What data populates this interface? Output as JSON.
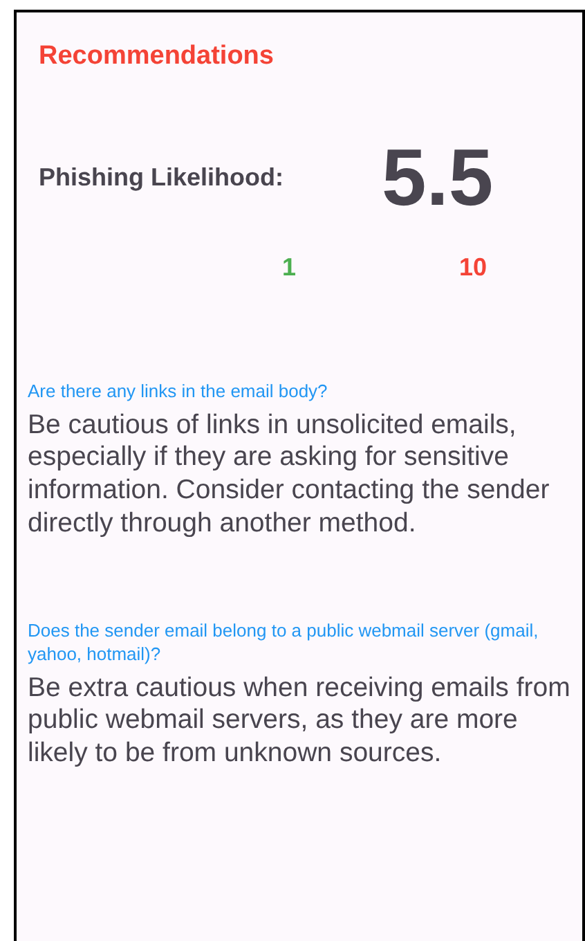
{
  "title": "Recommendations",
  "score": {
    "label": "Phishing Likelihood:",
    "value": "5.5",
    "scale_min": "1",
    "scale_max": "10"
  },
  "recommendations": [
    {
      "question": "Are there any links in the email body?",
      "advice": "Be cautious of links in unsolicited emails, especially if they are asking for sensitive information. Consider contacting the sender directly through another method."
    },
    {
      "question": "Does the sender email belong to a public webmail server (gmail, yahoo, hotmail)?",
      "advice": "Be extra cautious when receiving emails from public webmail servers, as they are more likely to be from unknown sources."
    }
  ]
}
